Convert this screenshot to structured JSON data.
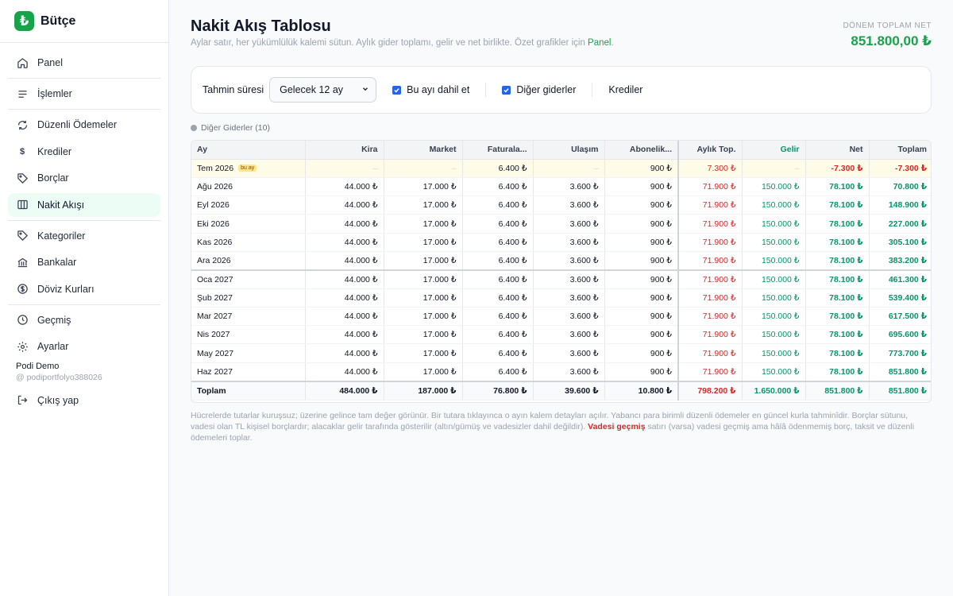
{
  "app": {
    "name": "Bütçe",
    "logo_glyph": "₺"
  },
  "sidebar": {
    "items": [
      {
        "label": "Panel",
        "icon": "home-icon"
      },
      {
        "label": "İşlemler",
        "icon": "list-icon"
      },
      {
        "label": "Düzenli Ödemeler",
        "icon": "repeat-icon"
      },
      {
        "label": "Krediler",
        "icon": "dollar-icon"
      },
      {
        "label": "Borçlar",
        "icon": "tag-icon"
      },
      {
        "label": "Nakit Akışı",
        "icon": "columns-icon",
        "active": true
      },
      {
        "label": "Kategoriler",
        "icon": "tag-icon"
      },
      {
        "label": "Bankalar",
        "icon": "bank-icon"
      },
      {
        "label": "Döviz Kurları",
        "icon": "currency-icon"
      },
      {
        "label": "Geçmiş",
        "icon": "clock-icon"
      },
      {
        "label": "Ayarlar",
        "icon": "gear-icon"
      }
    ],
    "user": {
      "name": "Podi Demo",
      "handle": "@ podiportfolyo388026"
    },
    "logout_label": "Çıkış yap"
  },
  "header": {
    "title": "Nakit Akış Tablosu",
    "subtitle": "Aylar satır, her yükümlülük kalemi sütun. Aylık gider toplamı, gelir ve net birlikte. Özet grafikler için",
    "subtitle_link": "Panel",
    "subtitle_end": ".",
    "total_label": "DÖNEM TOPLAM NET",
    "total_value": "851.800,00 ₺"
  },
  "filters": {
    "period_label": "Tahmin süresi",
    "period_value": "Gelecek 12 ay",
    "include_month_label": "Bu ayı dahil et",
    "other_expenses_label": "Diğer giderler",
    "loans_label": "Krediler"
  },
  "legend": {
    "label": "Diğer Giderler (10)"
  },
  "table": {
    "headers": [
      "Ay",
      "Kira",
      "Market",
      "Faturala...",
      "Ulaşım",
      "Abonelik...",
      "Aylık Top.",
      "Gelir",
      "Net",
      "Toplam"
    ],
    "rows": [
      {
        "month": "Tem 2026",
        "badge": "bu ay",
        "kira": "–",
        "market": "–",
        "fatura": "6.400 ₺",
        "ulasim": "–",
        "abonelik": "900 ₺",
        "aylik": "7.300 ₺",
        "gelir": "–",
        "net": "-7.300 ₺",
        "toplam": "-7.300 ₺"
      },
      {
        "month": "Ağu 2026",
        "kira": "44.000 ₺",
        "market": "17.000 ₺",
        "fatura": "6.400 ₺",
        "ulasim": "3.600 ₺",
        "abonelik": "900 ₺",
        "aylik": "71.900 ₺",
        "gelir": "150.000 ₺",
        "net": "78.100 ₺",
        "toplam": "70.800 ₺"
      },
      {
        "month": "Eyl 2026",
        "kira": "44.000 ₺",
        "market": "17.000 ₺",
        "fatura": "6.400 ₺",
        "ulasim": "3.600 ₺",
        "abonelik": "900 ₺",
        "aylik": "71.900 ₺",
        "gelir": "150.000 ₺",
        "net": "78.100 ₺",
        "toplam": "148.900 ₺"
      },
      {
        "month": "Eki 2026",
        "kira": "44.000 ₺",
        "market": "17.000 ₺",
        "fatura": "6.400 ₺",
        "ulasim": "3.600 ₺",
        "abonelik": "900 ₺",
        "aylik": "71.900 ₺",
        "gelir": "150.000 ₺",
        "net": "78.100 ₺",
        "toplam": "227.000 ₺"
      },
      {
        "month": "Kas 2026",
        "kira": "44.000 ₺",
        "market": "17.000 ₺",
        "fatura": "6.400 ₺",
        "ulasim": "3.600 ₺",
        "abonelik": "900 ₺",
        "aylik": "71.900 ₺",
        "gelir": "150.000 ₺",
        "net": "78.100 ₺",
        "toplam": "305.100 ₺"
      },
      {
        "month": "Ara 2026",
        "kira": "44.000 ₺",
        "market": "17.000 ₺",
        "fatura": "6.400 ₺",
        "ulasim": "3.600 ₺",
        "abonelik": "900 ₺",
        "aylik": "71.900 ₺",
        "gelir": "150.000 ₺",
        "net": "78.100 ₺",
        "toplam": "383.200 ₺"
      },
      {
        "month": "Oca 2027",
        "kira": "44.000 ₺",
        "market": "17.000 ₺",
        "fatura": "6.400 ₺",
        "ulasim": "3.600 ₺",
        "abonelik": "900 ₺",
        "aylik": "71.900 ₺",
        "gelir": "150.000 ₺",
        "net": "78.100 ₺",
        "toplam": "461.300 ₺",
        "year_break": true
      },
      {
        "month": "Şub 2027",
        "kira": "44.000 ₺",
        "market": "17.000 ₺",
        "fatura": "6.400 ₺",
        "ulasim": "3.600 ₺",
        "abonelik": "900 ₺",
        "aylik": "71.900 ₺",
        "gelir": "150.000 ₺",
        "net": "78.100 ₺",
        "toplam": "539.400 ₺"
      },
      {
        "month": "Mar 2027",
        "kira": "44.000 ₺",
        "market": "17.000 ₺",
        "fatura": "6.400 ₺",
        "ulasim": "3.600 ₺",
        "abonelik": "900 ₺",
        "aylik": "71.900 ₺",
        "gelir": "150.000 ₺",
        "net": "78.100 ₺",
        "toplam": "617.500 ₺"
      },
      {
        "month": "Nis 2027",
        "kira": "44.000 ₺",
        "market": "17.000 ₺",
        "fatura": "6.400 ₺",
        "ulasim": "3.600 ₺",
        "abonelik": "900 ₺",
        "aylik": "71.900 ₺",
        "gelir": "150.000 ₺",
        "net": "78.100 ₺",
        "toplam": "695.600 ₺"
      },
      {
        "month": "May 2027",
        "kira": "44.000 ₺",
        "market": "17.000 ₺",
        "fatura": "6.400 ₺",
        "ulasim": "3.600 ₺",
        "abonelik": "900 ₺",
        "aylik": "71.900 ₺",
        "gelir": "150.000 ₺",
        "net": "78.100 ₺",
        "toplam": "773.700 ₺"
      },
      {
        "month": "Haz 2027",
        "kira": "44.000 ₺",
        "market": "17.000 ₺",
        "fatura": "6.400 ₺",
        "ulasim": "3.600 ₺",
        "abonelik": "900 ₺",
        "aylik": "71.900 ₺",
        "gelir": "150.000 ₺",
        "net": "78.100 ₺",
        "toplam": "851.800 ₺"
      }
    ],
    "totals": {
      "month": "Toplam",
      "kira": "484.000 ₺",
      "market": "187.000 ₺",
      "fatura": "76.800 ₺",
      "ulasim": "39.600 ₺",
      "abonelik": "10.800 ₺",
      "aylik": "798.200 ₺",
      "gelir": "1.650.000 ₺",
      "net": "851.800 ₺",
      "toplam": "851.800 ₺"
    }
  },
  "footnote": {
    "part1": "Hücrelerde tutarlar kuruşsuz; üzerine gelince tam değer görünür. Bir tutara tıklayınca o ayın kalem detayları açılır. Yabancı para birimli düzenli ödemeler en güncel kurla tahminîdir. Borçlar sütunu, vadesi olan TL kişisel borçlardır; alacaklar gelir tarafında gösterilir (altın/gümüş ve vadesizler dahil değildir).",
    "highlight": "Vadesi geçmiş",
    "part2": "satırı (varsa) vadesi geçmiş ama hâlâ ödenmemiş borç, taksit ve düzenli ödemeleri toplar."
  },
  "colors": {
    "accent": "#16a34a",
    "negative": "#dc2626",
    "positive": "#059669",
    "highlight_row": "#fefce8"
  }
}
